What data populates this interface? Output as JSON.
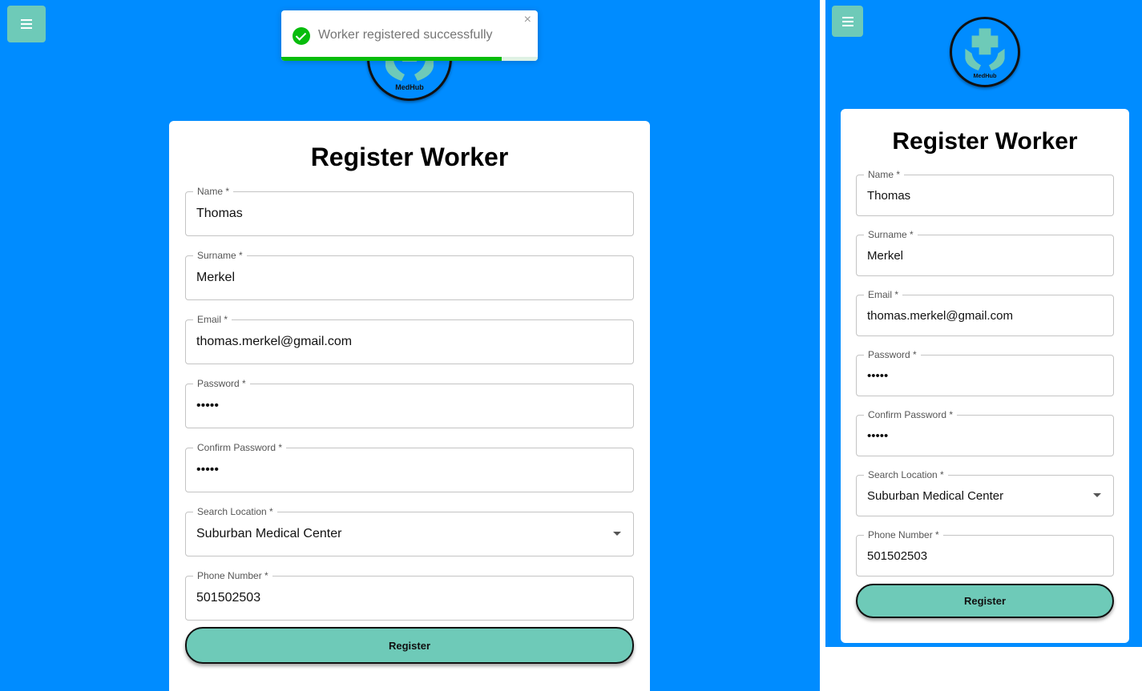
{
  "menu_icon": "hamburger-icon",
  "logo": {
    "text": "MedHub",
    "icon": "medical-cross-hands-icon"
  },
  "toast": {
    "message": "Worker registered successfully",
    "close": "×",
    "icon": "check-circle-icon",
    "progress_fraction": 0.86
  },
  "form": {
    "title": "Register Worker",
    "fields": [
      {
        "label": "Name *",
        "value": "Thomas"
      },
      {
        "label": "Surname *",
        "value": "Merkel"
      },
      {
        "label": "Email *",
        "value": "thomas.merkel@gmail.com"
      },
      {
        "label": "Password *",
        "value": "•••••"
      },
      {
        "label": "Confirm Password *",
        "value": "•••••"
      },
      {
        "label": "Search Location *",
        "value": "Suburban Medical Center"
      },
      {
        "label": "Phone Number *",
        "value": "501502503"
      }
    ],
    "submit_label": "Register"
  },
  "colors": {
    "background": "#008cff",
    "accent": "#6ecab8",
    "success": "#07bc0c"
  }
}
